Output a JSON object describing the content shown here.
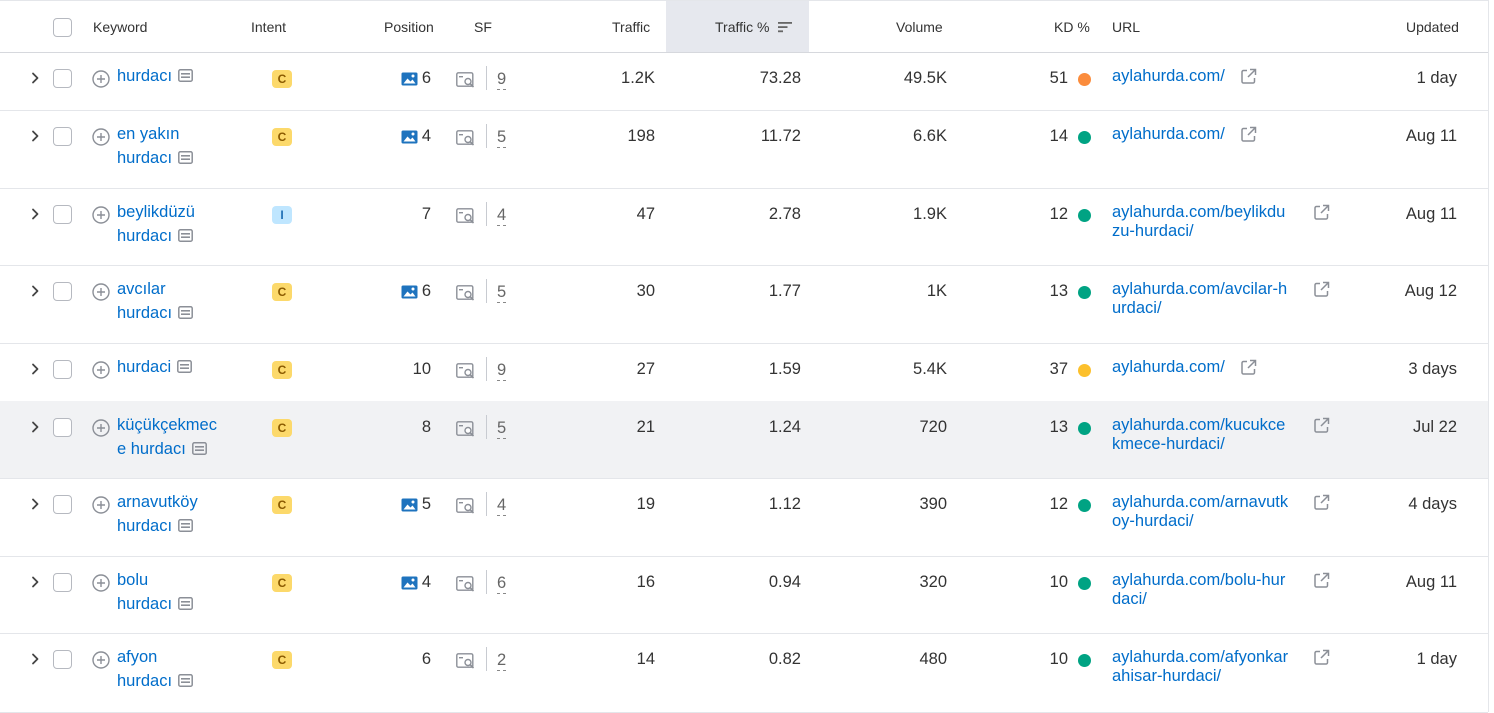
{
  "columns": {
    "keyword": "Keyword",
    "intent": "Intent",
    "position": "Position",
    "sf": "SF",
    "traffic": "Traffic",
    "traffic_pct": "Traffic %",
    "volume": "Volume",
    "kd": "KD %",
    "url": "URL",
    "updated": "Updated"
  },
  "colors": {
    "link": "#006dca",
    "kd_orange": "#fb8c3c",
    "kd_green": "#00a383",
    "kd_yellow": "#fcc02c"
  },
  "rows": [
    {
      "kw1": "hurdacı",
      "kw2": "",
      "intent": "C",
      "pos": "6",
      "pos_icon": true,
      "sf": "9",
      "traffic": "1.2K",
      "traffic_pct": "73.28",
      "volume": "49.5K",
      "kd": "51",
      "kd_level": "orange",
      "url1": "aylahurda.com/",
      "url2": "",
      "updated": "1 day"
    },
    {
      "kw1": "en yakın",
      "kw2": "hurdacı",
      "intent": "C",
      "pos": "4",
      "pos_icon": true,
      "sf": "5",
      "traffic": "198",
      "traffic_pct": "11.72",
      "volume": "6.6K",
      "kd": "14",
      "kd_level": "green",
      "url1": "aylahurda.com/",
      "url2": "",
      "updated": "Aug 11"
    },
    {
      "kw1": "beylikdüzü",
      "kw2": "hurdacı",
      "intent": "I",
      "pos": "7",
      "pos_icon": false,
      "sf": "4",
      "traffic": "47",
      "traffic_pct": "2.78",
      "volume": "1.9K",
      "kd": "12",
      "kd_level": "green",
      "url1": "aylahurda.com/beylikdu",
      "url2": "zu-hurdaci/",
      "updated": "Aug 11"
    },
    {
      "kw1": "avcılar",
      "kw2": "hurdacı",
      "intent": "C",
      "pos": "6",
      "pos_icon": true,
      "sf": "5",
      "traffic": "30",
      "traffic_pct": "1.77",
      "volume": "1K",
      "kd": "13",
      "kd_level": "green",
      "url1": "aylahurda.com/avcilar-h",
      "url2": "urdaci/",
      "updated": "Aug 12"
    },
    {
      "kw1": "hurdaci",
      "kw2": "",
      "intent": "C",
      "pos": "10",
      "pos_icon": false,
      "sf": "9",
      "traffic": "27",
      "traffic_pct": "1.59",
      "volume": "5.4K",
      "kd": "37",
      "kd_level": "yellow",
      "url1": "aylahurda.com/",
      "url2": "",
      "updated": "3 days"
    },
    {
      "kw1": "küçükçekmec",
      "kw2": "e hurdacı",
      "intent": "C",
      "pos": "8",
      "pos_icon": false,
      "sf": "5",
      "traffic": "21",
      "traffic_pct": "1.24",
      "volume": "720",
      "kd": "13",
      "kd_level": "green",
      "url1": "aylahurda.com/kucukce",
      "url2": "kmece-hurdaci/",
      "updated": "Jul 22"
    },
    {
      "kw1": "arnavutköy",
      "kw2": "hurdacı",
      "intent": "C",
      "pos": "5",
      "pos_icon": true,
      "sf": "4",
      "traffic": "19",
      "traffic_pct": "1.12",
      "volume": "390",
      "kd": "12",
      "kd_level": "green",
      "url1": "aylahurda.com/arnavutk",
      "url2": "oy-hurdaci/",
      "updated": "4 days"
    },
    {
      "kw1": "bolu",
      "kw2": "hurdacı",
      "intent": "C",
      "pos": "4",
      "pos_icon": true,
      "sf": "6",
      "traffic": "16",
      "traffic_pct": "0.94",
      "volume": "320",
      "kd": "10",
      "kd_level": "green",
      "url1": "aylahurda.com/bolu-hur",
      "url2": "daci/",
      "updated": "Aug 11"
    },
    {
      "kw1": "afyon",
      "kw2": "hurdacı",
      "intent": "C",
      "pos": "6",
      "pos_icon": false,
      "sf": "2",
      "traffic": "14",
      "traffic_pct": "0.82",
      "volume": "480",
      "kd": "10",
      "kd_level": "green",
      "url1": "aylahurda.com/afyonkar",
      "url2": "ahisar-hurdaci/",
      "updated": "1 day"
    }
  ]
}
